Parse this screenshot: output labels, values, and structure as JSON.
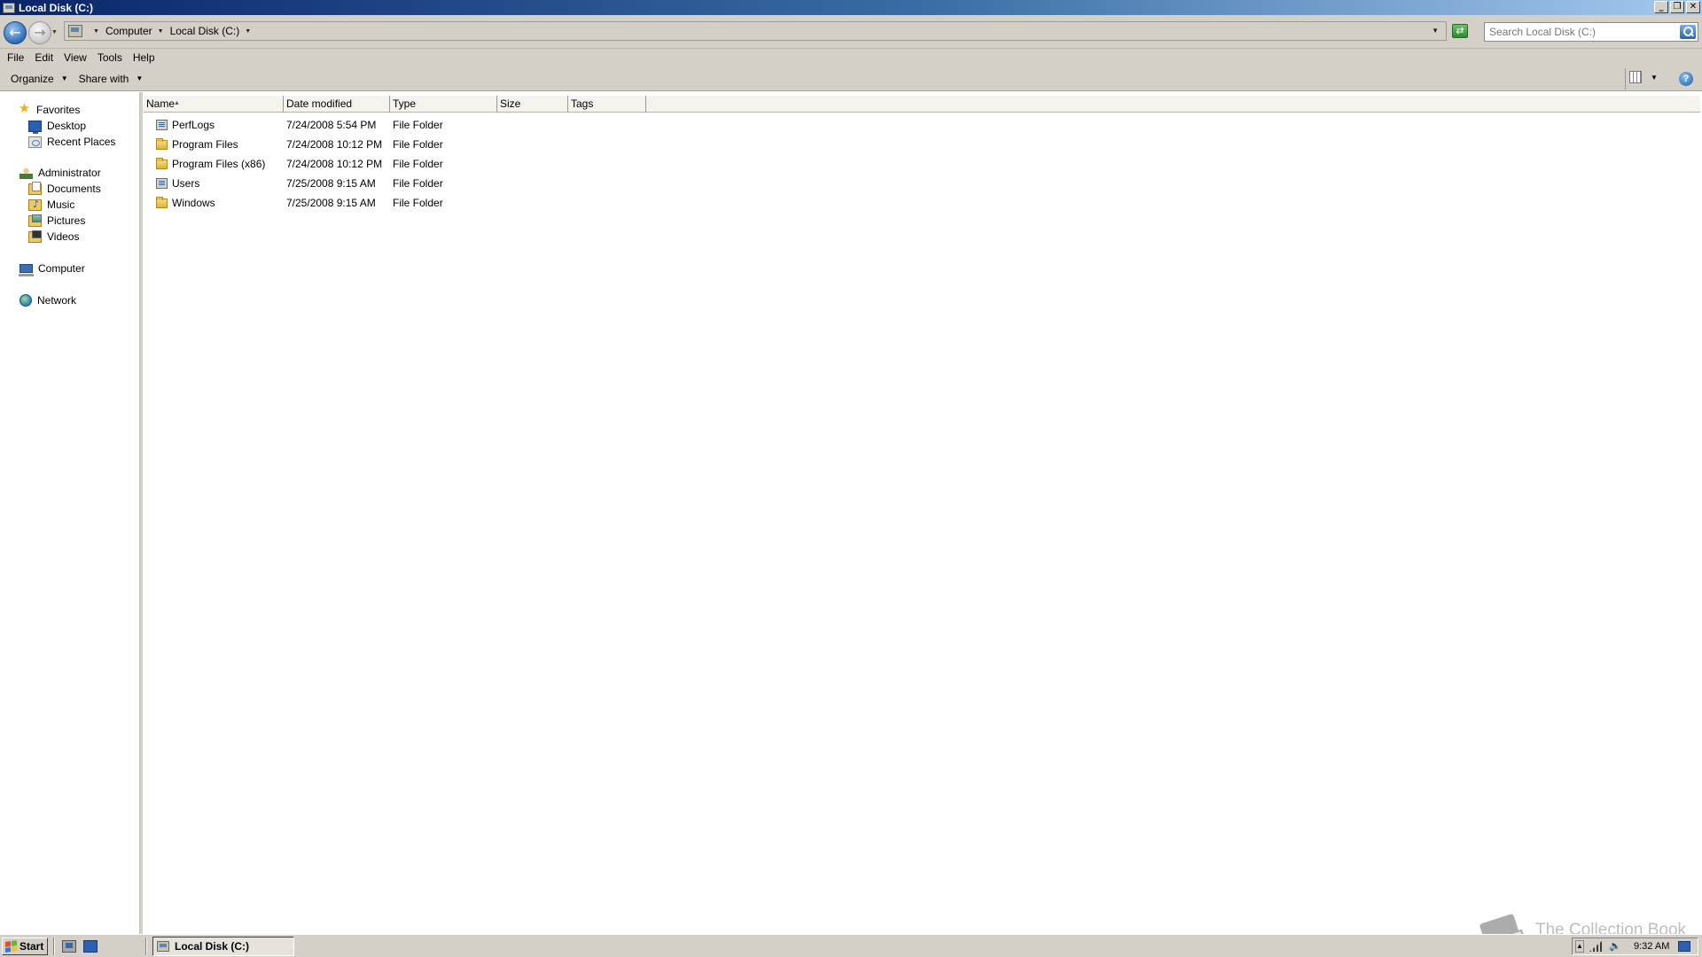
{
  "window": {
    "title": "Local Disk (C:)",
    "controls": [
      "minimize",
      "restore",
      "close"
    ]
  },
  "address": {
    "breadcrumbs": [
      "Computer",
      "Local Disk (C:)"
    ],
    "search_placeholder": "Search Local Disk (C:)"
  },
  "menu": {
    "items": [
      "File",
      "Edit",
      "View",
      "Tools",
      "Help"
    ]
  },
  "commands": {
    "organize": "Organize",
    "share_with": "Share with"
  },
  "nav": {
    "favorites": {
      "label": "Favorites",
      "items": [
        "Desktop",
        "Recent Places"
      ]
    },
    "user": {
      "label": "Administrator",
      "items": [
        "Documents",
        "Music",
        "Pictures",
        "Videos"
      ]
    },
    "computer": "Computer",
    "network": "Network"
  },
  "columns": [
    "Name",
    "Date modified",
    "Type",
    "Size",
    "Tags"
  ],
  "files": [
    {
      "name": "PerfLogs",
      "date": "7/24/2008 5:54 PM",
      "type": "File Folder",
      "size": "",
      "icon": "system-folder-icon"
    },
    {
      "name": "Program Files",
      "date": "7/24/2008 10:12 PM",
      "type": "File Folder",
      "size": "",
      "icon": "folder-icon"
    },
    {
      "name": "Program Files (x86)",
      "date": "7/24/2008 10:12 PM",
      "type": "File Folder",
      "size": "",
      "icon": "folder-icon"
    },
    {
      "name": "Users",
      "date": "7/25/2008 9:15 AM",
      "type": "File Folder",
      "size": "",
      "icon": "system-folder-icon"
    },
    {
      "name": "Windows",
      "date": "7/25/2008 9:15 AM",
      "type": "File Folder",
      "size": "",
      "icon": "folder-icon"
    }
  ],
  "taskbar": {
    "start_label": "Start",
    "task_title": "Local Disk (C:)",
    "clock": "9:32 AM"
  },
  "watermark": "The Collection Book",
  "colors": {
    "titlebar_start": "#0a246a",
    "titlebar_end": "#a6caf0",
    "chrome": "#d4d0c8"
  }
}
